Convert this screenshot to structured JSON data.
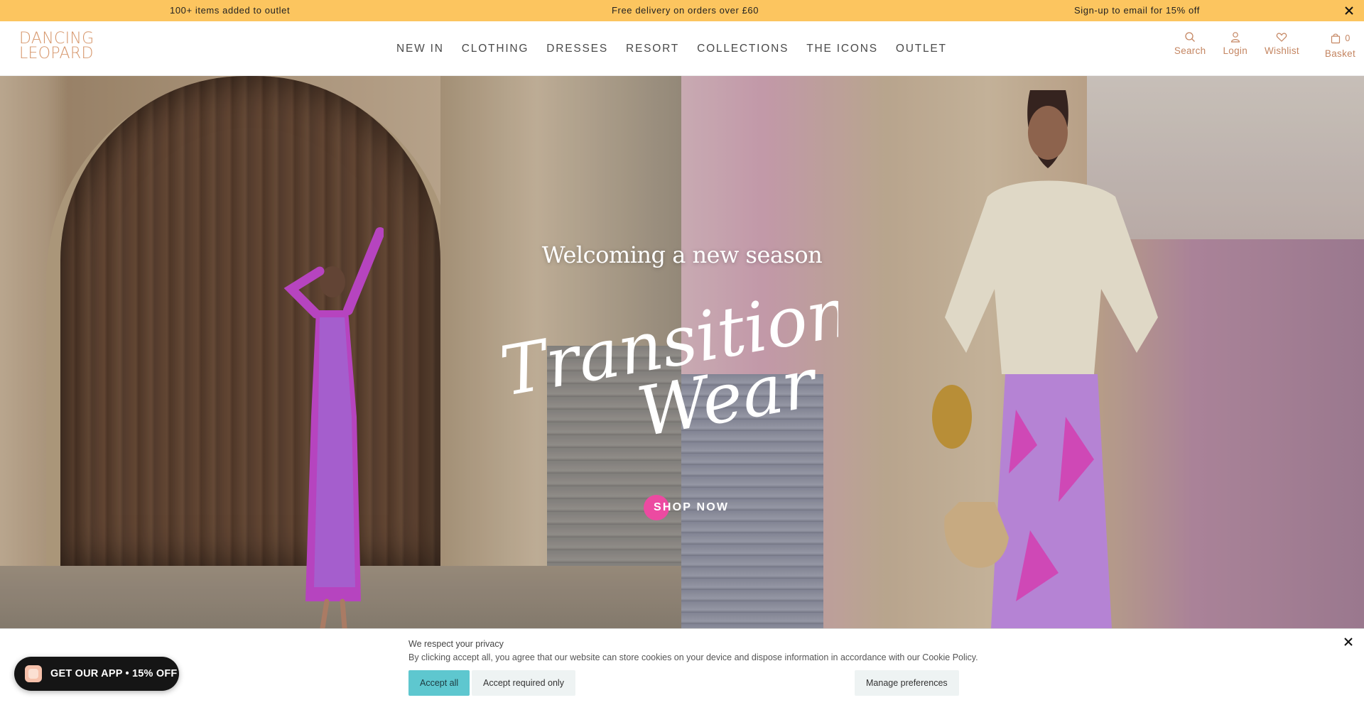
{
  "announcement": {
    "messages": [
      "100+ items added to outlet",
      "Free delivery on orders over £60",
      "Sign-up to email for 15% off"
    ]
  },
  "brand": {
    "logo_line1": "DANCING",
    "logo_line2": "LEOPARD",
    "color": "#d6966b"
  },
  "nav": {
    "items": [
      "NEW IN",
      "CLOTHING",
      "DRESSES",
      "RESORT",
      "COLLECTIONS",
      "THE ICONS",
      "OUTLET"
    ]
  },
  "utilities": {
    "search": "Search",
    "login": "Login",
    "wishlist": "Wishlist",
    "basket": "Basket",
    "basket_count": "0"
  },
  "hero": {
    "subtitle": "Welcoming a new season",
    "title_line1": "Transitional",
    "title_line2": "Wear",
    "cta": "SHOP NOW",
    "cta_color": "#ec4aa1"
  },
  "cookie": {
    "title": "We respect your privacy",
    "text": "By clicking accept all, you agree that our website can store cookies on your device and dispose information in accordance with our Cookie Policy.",
    "accept_all": "Accept all",
    "accept_required": "Accept required only",
    "manage": "Manage preferences"
  },
  "app_promo": {
    "label": "GET OUR APP • 15% OFF"
  },
  "colors": {
    "announcement_bg": "#fcc55f",
    "accent": "#c48561",
    "accept_button": "#5ec7cf"
  }
}
